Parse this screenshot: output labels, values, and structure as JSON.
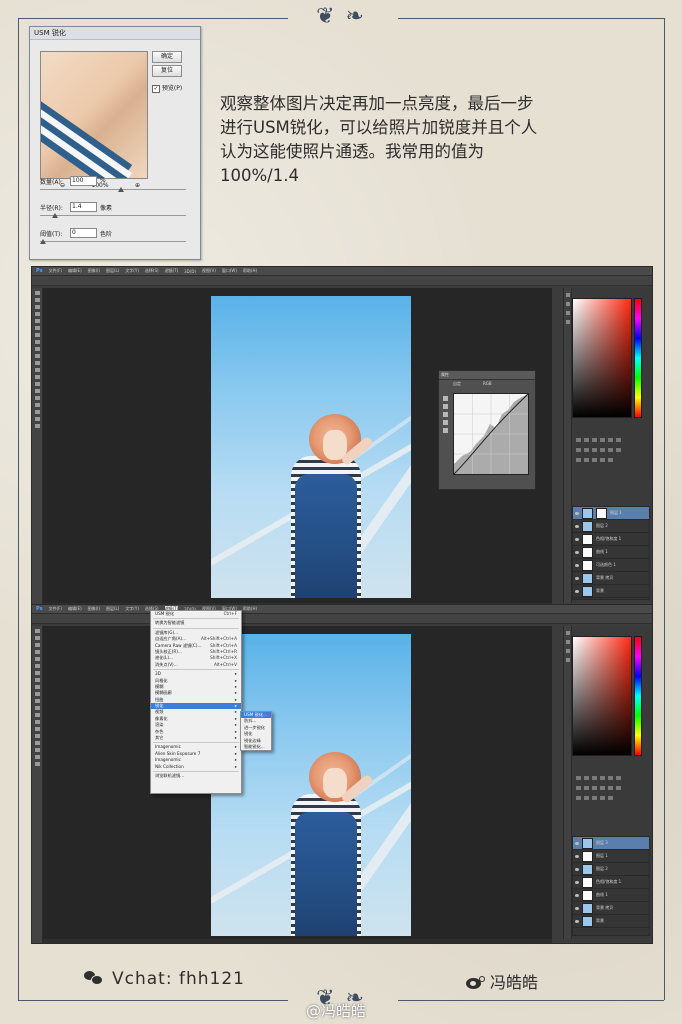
{
  "usm_dialog": {
    "title": "USM 锐化",
    "ok_label": "确定",
    "reset_label": "复位",
    "preview_label": "预览(P)",
    "preview_checked": true,
    "zoom_level": "100%",
    "amount_label": "数量(A):",
    "amount_value": "100",
    "amount_unit": "%",
    "radius_label": "半径(R):",
    "radius_value": "1.4",
    "radius_unit": "像素",
    "threshold_label": "阈值(T):",
    "threshold_value": "0",
    "threshold_unit": "色阶"
  },
  "caption": {
    "line1": "观察整体图片决定再加一点亮度，最后一步",
    "line2": "进行USM锐化，可以给照片加锐度并且个人",
    "line3": "认为这能使照片通透。我常用的值为",
    "line4": "100%/1.4"
  },
  "ps_menu": [
    "文件(F)",
    "编辑(E)",
    "图像(I)",
    "图层(L)",
    "文字(Y)",
    "选择(S)",
    "滤镜(T)",
    "3D(D)",
    "视图(V)",
    "窗口(W)",
    "帮助(H)"
  ],
  "ps_logo": "Ps",
  "curves_panel": {
    "title": "属性",
    "preset": "自定",
    "channel": "RGB"
  },
  "filter_menu": {
    "items": [
      {
        "label": "USM 锐化",
        "shortcut": "Ctrl+F"
      },
      {
        "label": "转换为智能滤镜"
      },
      {
        "label": "滤镜库(G)..."
      },
      {
        "label": "自适应广角(A)...",
        "shortcut": "Alt+Shift+Ctrl+A"
      },
      {
        "label": "Camera Raw 滤镜(C)...",
        "shortcut": "Shift+Ctrl+A"
      },
      {
        "label": "镜头校正(R)...",
        "shortcut": "Shift+Ctrl+R"
      },
      {
        "label": "液化(L)...",
        "shortcut": "Shift+Ctrl+X"
      },
      {
        "label": "消失点(V)...",
        "shortcut": "Alt+Ctrl+V"
      },
      {
        "label": "3D"
      },
      {
        "label": "风格化"
      },
      {
        "label": "模糊"
      },
      {
        "label": "模糊画廊"
      },
      {
        "label": "扭曲"
      },
      {
        "label": "锐化"
      },
      {
        "label": "视频"
      },
      {
        "label": "像素化"
      },
      {
        "label": "渲染"
      },
      {
        "label": "杂色"
      },
      {
        "label": "其它"
      },
      {
        "label": "Imagenomic"
      },
      {
        "label": "Alien Skin Exposure 7"
      },
      {
        "label": "Imagenomic"
      },
      {
        "label": "Nik Collection"
      },
      {
        "label": "浏览联机滤镜..."
      }
    ],
    "highlighted": "锐化",
    "submenu": [
      "USM 锐化...",
      "防抖...",
      "进一步锐化",
      "锐化",
      "锐化边缘",
      "智能锐化..."
    ],
    "submenu_highlighted": "USM 锐化..."
  },
  "layers_top": [
    "图层 1",
    "图层 2",
    "色相/饱和度 1",
    "曲线 1",
    "可选颜色 1",
    "背景 拷贝",
    "背景"
  ],
  "layers_bottom": [
    "图层 3",
    "图层 1",
    "图层 2",
    "色相/饱和度 1",
    "曲线 1",
    "背景 拷贝",
    "背景"
  ],
  "footer": {
    "wechat_text": "Vchat: fhh121",
    "weibo_text": "冯皓皓",
    "watermark": "@冯皓皓"
  },
  "colors": {
    "paper": "#e6e0d3",
    "frame": "#4b5a6b",
    "ps_bg": "#3c3c3c",
    "highlight": "#3d7ddc"
  }
}
